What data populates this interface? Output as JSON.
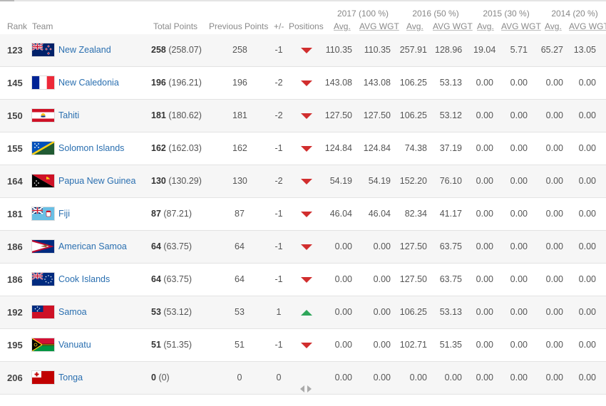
{
  "header": {
    "years": [
      "2017 (100 %)",
      "2016 (50 %)",
      "2015 (30 %)",
      "2014 (20 %)"
    ],
    "rank": "Rank",
    "team": "Team",
    "total_points": "Total Points",
    "previous_points": "Previous Points",
    "plus_minus": "+/-",
    "positions": "Positions",
    "avg": "Avg.",
    "avg_wgt": "AVG WGT"
  },
  "colors": {
    "link": "#2a6fb0",
    "down": "#d12e2e",
    "up": "#2fa65a"
  },
  "rows": [
    {
      "rank": "123",
      "team": "New Zealand",
      "flag": "new-zealand-flag-icon",
      "total": "258",
      "total_exact": "(258.07)",
      "previous": "258",
      "change": "-1",
      "trend": "down",
      "v": [
        "110.35",
        "110.35",
        "257.91",
        "128.96",
        "19.04",
        "5.71",
        "65.27",
        "13.05"
      ]
    },
    {
      "rank": "145",
      "team": "New Caledonia",
      "flag": "new-caledonia-flag-icon",
      "total": "196",
      "total_exact": "(196.21)",
      "previous": "196",
      "change": "-2",
      "trend": "down",
      "v": [
        "143.08",
        "143.08",
        "106.25",
        "53.13",
        "0.00",
        "0.00",
        "0.00",
        "0.00"
      ]
    },
    {
      "rank": "150",
      "team": "Tahiti",
      "flag": "tahiti-flag-icon",
      "total": "181",
      "total_exact": "(180.62)",
      "previous": "181",
      "change": "-2",
      "trend": "down",
      "v": [
        "127.50",
        "127.50",
        "106.25",
        "53.12",
        "0.00",
        "0.00",
        "0.00",
        "0.00"
      ]
    },
    {
      "rank": "155",
      "team": "Solomon Islands",
      "flag": "solomon-islands-flag-icon",
      "total": "162",
      "total_exact": "(162.03)",
      "previous": "162",
      "change": "-1",
      "trend": "down",
      "v": [
        "124.84",
        "124.84",
        "74.38",
        "37.19",
        "0.00",
        "0.00",
        "0.00",
        "0.00"
      ]
    },
    {
      "rank": "164",
      "team": "Papua New Guinea",
      "flag": "papua-new-guinea-flag-icon",
      "total": "130",
      "total_exact": "(130.29)",
      "previous": "130",
      "change": "-2",
      "trend": "down",
      "v": [
        "54.19",
        "54.19",
        "152.20",
        "76.10",
        "0.00",
        "0.00",
        "0.00",
        "0.00"
      ]
    },
    {
      "rank": "181",
      "team": "Fiji",
      "flag": "fiji-flag-icon",
      "total": "87",
      "total_exact": "(87.21)",
      "previous": "87",
      "change": "-1",
      "trend": "down",
      "v": [
        "46.04",
        "46.04",
        "82.34",
        "41.17",
        "0.00",
        "0.00",
        "0.00",
        "0.00"
      ]
    },
    {
      "rank": "186",
      "team": "American Samoa",
      "flag": "american-samoa-flag-icon",
      "total": "64",
      "total_exact": "(63.75)",
      "previous": "64",
      "change": "-1",
      "trend": "down",
      "v": [
        "0.00",
        "0.00",
        "127.50",
        "63.75",
        "0.00",
        "0.00",
        "0.00",
        "0.00"
      ]
    },
    {
      "rank": "186",
      "team": "Cook Islands",
      "flag": "cook-islands-flag-icon",
      "total": "64",
      "total_exact": "(63.75)",
      "previous": "64",
      "change": "-1",
      "trend": "down",
      "v": [
        "0.00",
        "0.00",
        "127.50",
        "63.75",
        "0.00",
        "0.00",
        "0.00",
        "0.00"
      ]
    },
    {
      "rank": "192",
      "team": "Samoa",
      "flag": "samoa-flag-icon",
      "total": "53",
      "total_exact": "(53.12)",
      "previous": "53",
      "change": "1",
      "trend": "up",
      "v": [
        "0.00",
        "0.00",
        "106.25",
        "53.13",
        "0.00",
        "0.00",
        "0.00",
        "0.00"
      ]
    },
    {
      "rank": "195",
      "team": "Vanuatu",
      "flag": "vanuatu-flag-icon",
      "total": "51",
      "total_exact": "(51.35)",
      "previous": "51",
      "change": "-1",
      "trend": "down",
      "v": [
        "0.00",
        "0.00",
        "102.71",
        "51.35",
        "0.00",
        "0.00",
        "0.00",
        "0.00"
      ]
    },
    {
      "rank": "206",
      "team": "Tonga",
      "flag": "tonga-flag-icon",
      "total": "0",
      "total_exact": "(0)",
      "previous": "0",
      "change": "0",
      "trend": "same",
      "v": [
        "0.00",
        "0.00",
        "0.00",
        "0.00",
        "0.00",
        "0.00",
        "0.00",
        "0.00"
      ]
    }
  ]
}
